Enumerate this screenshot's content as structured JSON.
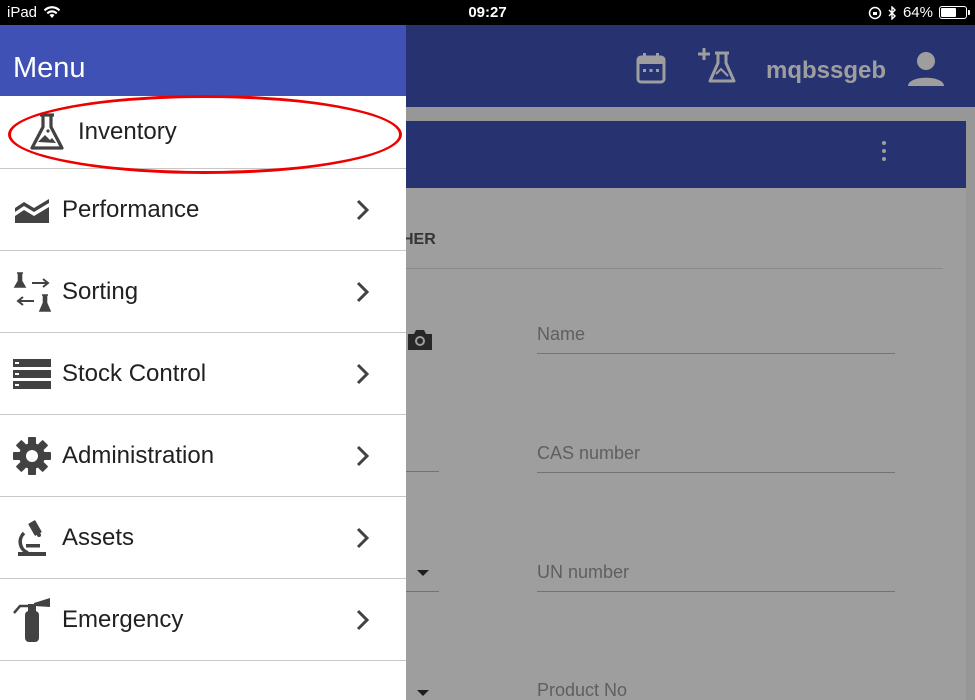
{
  "status_bar": {
    "device": "iPad",
    "time": "09:27",
    "battery": "64%",
    "battery_level": 0.64
  },
  "app_header": {
    "username": "mqbssgeb",
    "icons": [
      "calendar-icon",
      "add-flask-icon",
      "account-icon"
    ]
  },
  "form": {
    "tab_label": "HER",
    "fields": [
      {
        "placeholder": "Name"
      },
      {
        "placeholder": "CAS number"
      },
      {
        "placeholder": "UN number"
      },
      {
        "placeholder": "Product No"
      }
    ]
  },
  "drawer": {
    "title": "Menu",
    "items": [
      {
        "label": "Inventory",
        "icon": "flask-icon",
        "has_chevron": false,
        "highlighted": true
      },
      {
        "label": "Performance",
        "icon": "area-chart-icon",
        "has_chevron": true
      },
      {
        "label": "Sorting",
        "icon": "sorting-icon",
        "has_chevron": true
      },
      {
        "label": "Stock Control",
        "icon": "storage-icon",
        "has_chevron": true
      },
      {
        "label": "Administration",
        "icon": "gear-icon",
        "has_chevron": true
      },
      {
        "label": "Assets",
        "icon": "microscope-icon",
        "has_chevron": true
      },
      {
        "label": "Emergency",
        "icon": "fire-extinguisher-icon",
        "has_chevron": true
      }
    ]
  },
  "colors": {
    "primary": "#3f51b5",
    "highlight": "#e00000"
  }
}
